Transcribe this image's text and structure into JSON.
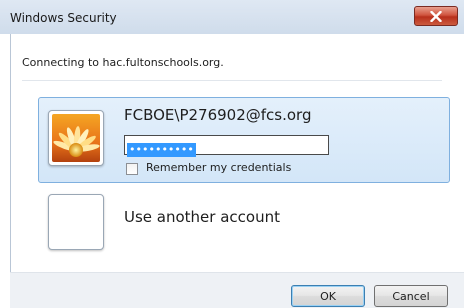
{
  "window": {
    "title": "Windows Security",
    "close_icon": "close-icon"
  },
  "dialog": {
    "connecting_text": "Connecting to hac.fultonschools.org."
  },
  "account": {
    "username": "FCBOE\\P276902@fcs.org",
    "password_masked": "••••••••••",
    "remember_label": "Remember my credentials",
    "remember_checked": false,
    "tile_icon": "flower-user-icon"
  },
  "other_account": {
    "label": "Use another account",
    "tile_icon": "blank-user-icon"
  },
  "buttons": {
    "ok": "OK",
    "cancel": "Cancel"
  },
  "colors": {
    "selection_highlight": "#3399ff",
    "selected_row_bg": "#d3e6f8",
    "close_button": "#c7422b"
  }
}
